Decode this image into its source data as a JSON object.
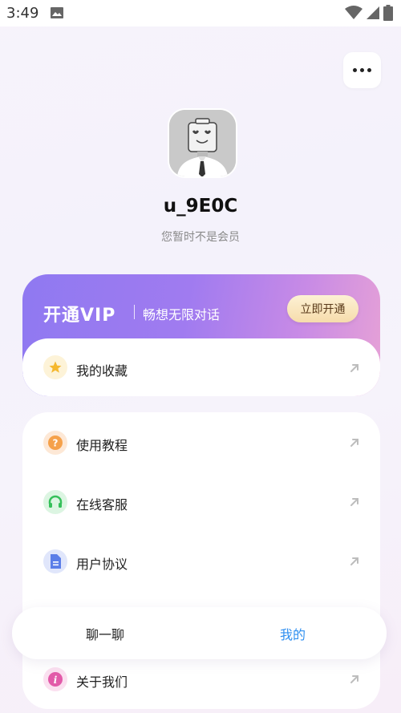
{
  "status_bar": {
    "time": "3:49"
  },
  "profile": {
    "username": "u_9E0C",
    "member_status": "您暂时不是会员"
  },
  "vip": {
    "title": "开通VIP",
    "subtitle": "畅想无限对话",
    "button": "立即开通"
  },
  "favorites": {
    "label": "我的收藏"
  },
  "menu": {
    "items": [
      {
        "label": "使用教程",
        "icon": "question-icon"
      },
      {
        "label": "在线客服",
        "icon": "headset-icon"
      },
      {
        "label": "用户协议",
        "icon": "document-icon"
      },
      {
        "label": "关于我们",
        "icon": "info-icon"
      }
    ]
  },
  "tabs": [
    {
      "label": "聊一聊"
    },
    {
      "label": "我的"
    }
  ],
  "colors": {
    "accent": "#2f8ff0",
    "vip_gradient_start": "#8f79f1",
    "vip_gradient_end": "#e7a2d6",
    "vip_button": "#f6dcac"
  }
}
